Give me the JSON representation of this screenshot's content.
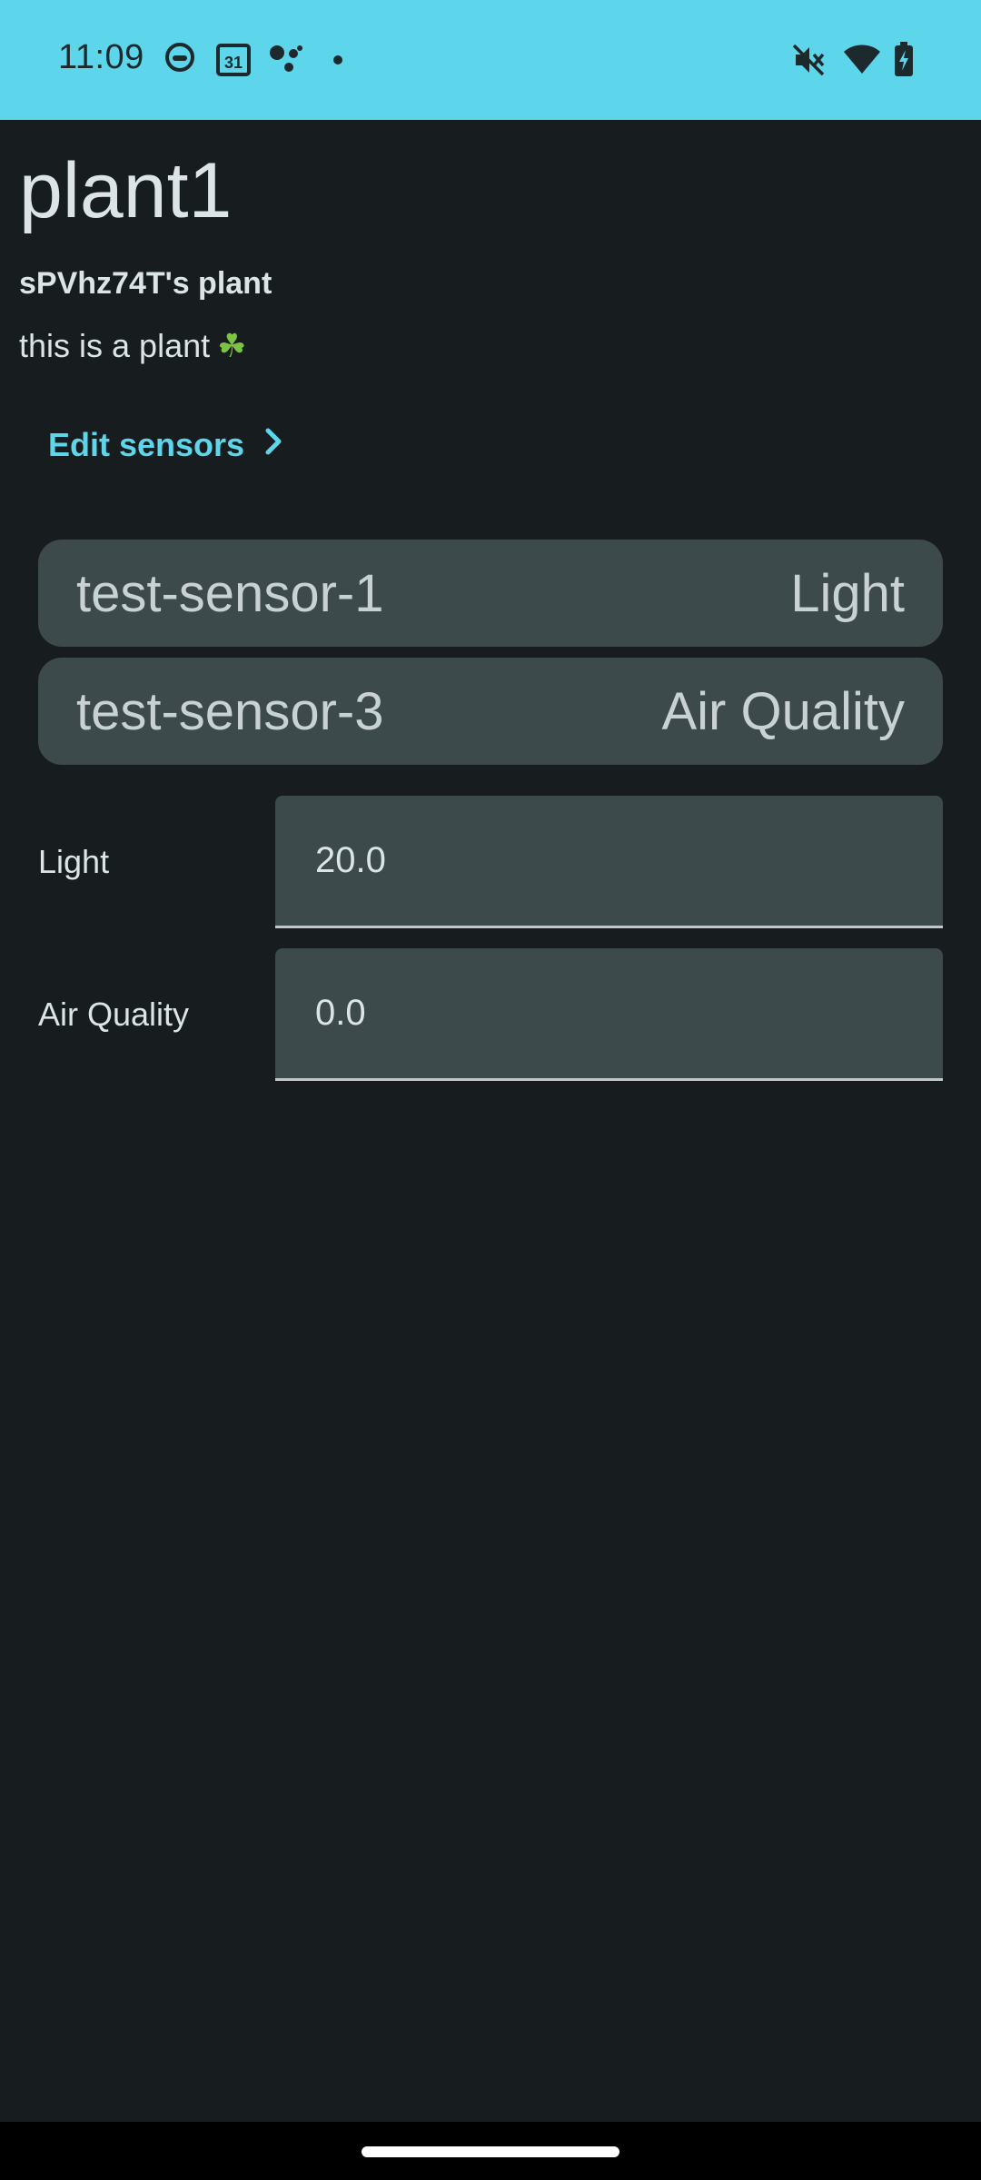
{
  "status_bar": {
    "time": "11:09",
    "calendar_day": "31",
    "icons": [
      "cat-face-icon",
      "calendar-icon",
      "assistant-icon",
      "dot-icon",
      "mute-icon",
      "wifi-icon",
      "battery-charging-icon"
    ]
  },
  "plant": {
    "title": "plant1",
    "owner": "sPVhz74T's plant",
    "description": "this is a plant",
    "description_emoji": "☘"
  },
  "edit_sensors": {
    "label": "Edit sensors",
    "icon": "chevron-right-icon"
  },
  "sensors": [
    {
      "name": "test-sensor-1",
      "type": "Light"
    },
    {
      "name": "test-sensor-3",
      "type": "Air Quality"
    }
  ],
  "fields": [
    {
      "label": "Light",
      "value": "20.0"
    },
    {
      "label": "Air Quality",
      "value": "0.0"
    }
  ],
  "colors": {
    "status_bar": "#5dd6eb",
    "background": "#171d1f",
    "accent": "#5dd6eb",
    "card": "#3d4a4c"
  }
}
